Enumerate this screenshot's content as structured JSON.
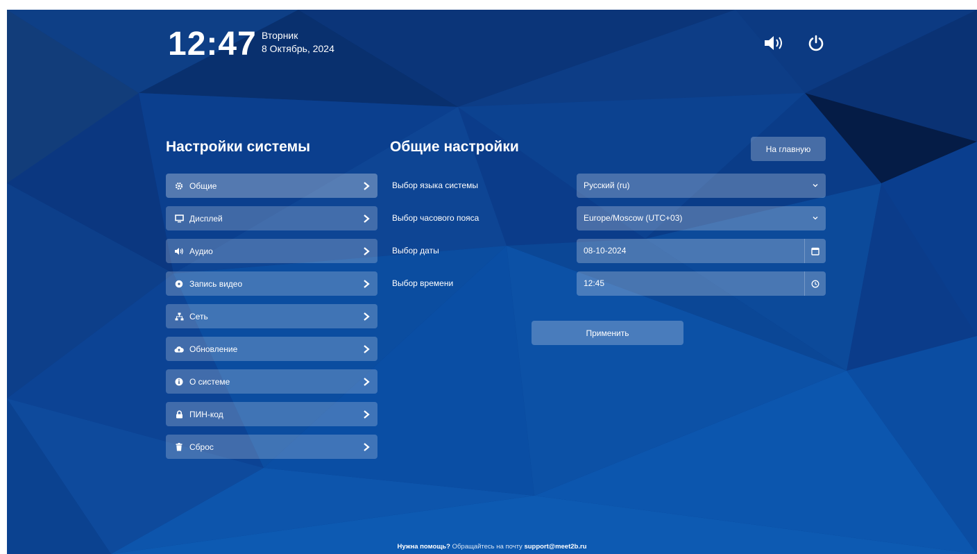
{
  "header": {
    "time": "12:47",
    "weekday": "Вторник",
    "date": "8 Октябрь, 2024"
  },
  "sidebar": {
    "title": "Настройки системы",
    "items": [
      {
        "label": "Общие",
        "icon": "gear-icon"
      },
      {
        "label": "Дисплей",
        "icon": "monitor-icon"
      },
      {
        "label": "Аудио",
        "icon": "speaker-icon"
      },
      {
        "label": "Запись видео",
        "icon": "record-icon"
      },
      {
        "label": "Сеть",
        "icon": "network-icon"
      },
      {
        "label": "Обновление",
        "icon": "cloud-upload-icon"
      },
      {
        "label": "О системе",
        "icon": "info-icon"
      },
      {
        "label": "ПИН-код",
        "icon": "lock-icon"
      },
      {
        "label": "Сброс",
        "icon": "trash-icon"
      }
    ]
  },
  "main": {
    "title": "Общие настройки",
    "home_button": "На главную",
    "fields": {
      "language": {
        "label": "Выбор языка системы",
        "value": "Русский (ru)"
      },
      "timezone": {
        "label": "Выбор часового пояса",
        "value": "Europe/Moscow (UTC+03)"
      },
      "date": {
        "label": "Выбор даты",
        "value": "08-10-2024"
      },
      "time": {
        "label": "Выбор времени",
        "value": "12:45"
      }
    },
    "apply_button": "Применить"
  },
  "footer": {
    "help": "Нужна помощь?",
    "text": "Обращайтесь на почту",
    "email": "support@meet2b.ru"
  },
  "colors": {
    "background": "#0a3a86",
    "panel": "rgba(255,255,255,0.22)"
  }
}
